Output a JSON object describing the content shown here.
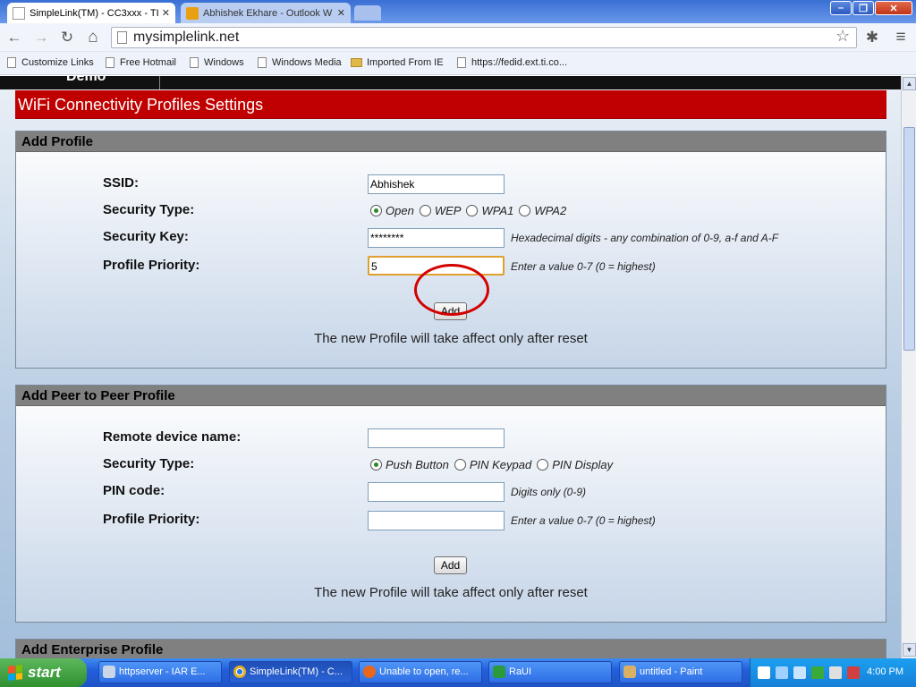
{
  "browser": {
    "tabs": [
      {
        "title": "SimpleLink(TM) - CC3xxx - TI",
        "close": "✕"
      },
      {
        "title": "Abhishek Ekhare - Outlook W",
        "close": "✕"
      }
    ],
    "window_controls": {
      "minimize": "–",
      "maximize": "❐",
      "close": "✕"
    },
    "address": "mysimplelink.net",
    "nav": {
      "back": "←",
      "forward": "→",
      "reload": "↻",
      "home": "⌂",
      "star": "☆",
      "extension": "✱",
      "menu": "≡"
    },
    "bookmarks": [
      "Customize Links",
      "Free Hotmail",
      "Windows",
      "Windows Media",
      "Imported From IE",
      "https://fedid.ext.ti.co..."
    ]
  },
  "page": {
    "demo_label": "Demo",
    "header": "WiFi Connectivity Profiles Settings",
    "add_profile": {
      "title": "Add Profile",
      "ssid_label": "SSID:",
      "ssid_value": "Abhishek",
      "security_type_label": "Security Type:",
      "security_options": [
        "Open",
        "WEP",
        "WPA1",
        "WPA2"
      ],
      "security_selected": "Open",
      "security_key_label": "Security Key:",
      "security_key_value": "********",
      "security_key_hint": "Hexadecimal digits - any combination of 0-9, a-f and A-F",
      "priority_label": "Profile Priority:",
      "priority_value": "5",
      "priority_hint": "Enter a value 0-7 (0 = highest)",
      "add_button": "Add",
      "note": "The new Profile will take affect only after reset"
    },
    "p2p_profile": {
      "title": "Add Peer to Peer Profile",
      "remote_label": "Remote device name:",
      "remote_value": "",
      "security_type_label": "Security Type:",
      "security_options": [
        "Push Button",
        "PIN Keypad",
        "PIN Display"
      ],
      "security_selected": "Push Button",
      "pin_label": "PIN code:",
      "pin_value": "",
      "pin_hint": "Digits only (0-9)",
      "priority_label": "Profile Priority:",
      "priority_value": "",
      "priority_hint": "Enter a value 0-7 (0 = highest)",
      "add_button": "Add",
      "note": "The new Profile will take affect only after reset"
    },
    "enterprise_title": "Add Enterprise Profile"
  },
  "taskbar": {
    "start": "start",
    "tasks": [
      "httpserver - IAR E...",
      "SimpleLink(TM) - C...",
      "Unable to open, re...",
      "RaUI",
      "untitled - Paint"
    ],
    "clock": "4:00 PM"
  },
  "colors": {
    "header_red": "#c00000",
    "annotation_circle": "#d40000",
    "panel_header": "#808080"
  }
}
